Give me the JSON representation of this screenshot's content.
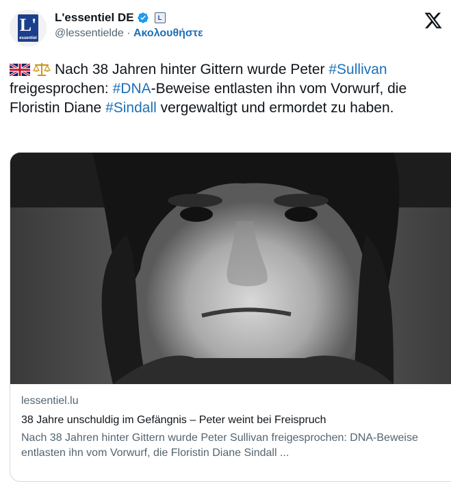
{
  "account": {
    "display_name": "L'essentiel DE",
    "handle": "@lessentielde",
    "separator": "·",
    "follow_label": "Ακολουθήστε",
    "logo_letter": "L'",
    "logo_word": "essentiel"
  },
  "icons": {
    "verified": "verified-badge-icon",
    "affiliate": "affiliate-badge-icon",
    "platform": "x-logo-icon",
    "flag": "uk-flag-icon",
    "scales": "balance-scale-icon"
  },
  "tweet": {
    "part1": "Nach 38 Jahren hinter Gittern wurde Peter ",
    "hashtag1": "#Sullivan",
    "part2": " freigesprochen: ",
    "hashtag2": "#DNA",
    "part3": "-Beweise entlasten ihn vom Vorwurf, die Floristin Diane ",
    "hashtag3": "#Sindall",
    "part4": " vergewaltigt und ermordet zu haben."
  },
  "card": {
    "domain": "lessentiel.lu",
    "title": "38 Jahre unschuldig im Gefängnis – Peter weint bei Freispruch",
    "description": "Nach 38 Jahren hinter Gittern wurde Peter Sullivan freigesprochen: DNA-Beweise entlasten ihn vom Vorwurf, die Floristin Diane Sindall ..."
  },
  "colors": {
    "link": "#1d6fb8",
    "verified": "#1d9bf0",
    "logo_blue": "#1b3f8b",
    "secondary_text": "#536471"
  }
}
